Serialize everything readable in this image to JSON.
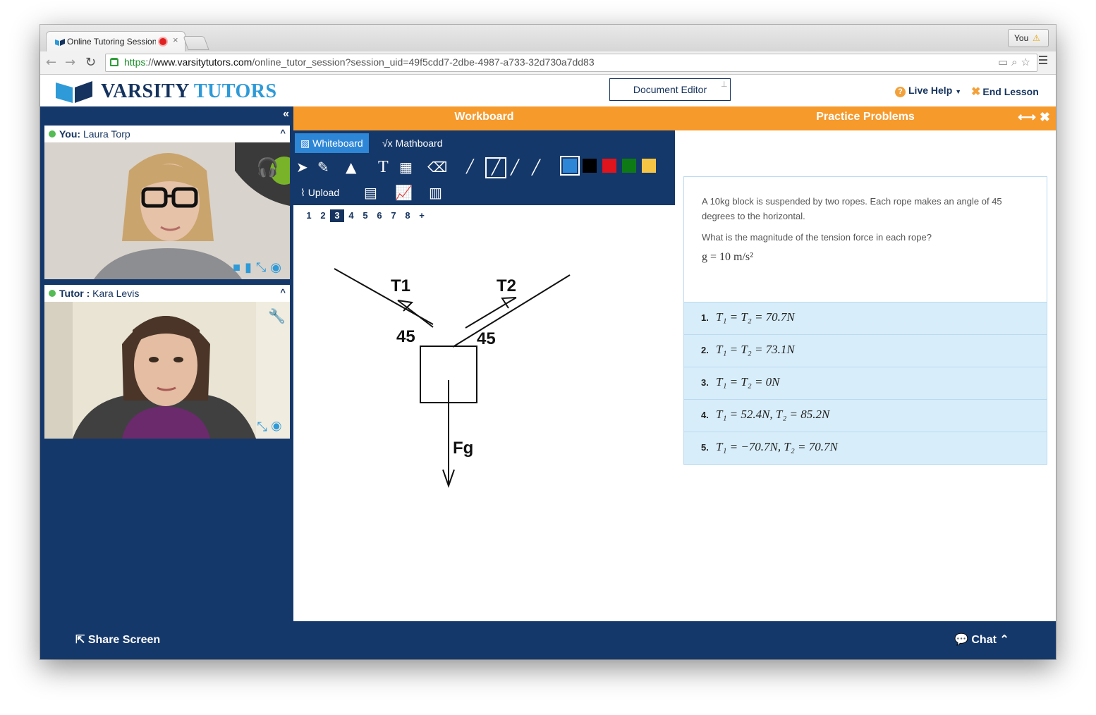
{
  "browser": {
    "tab_title": "Online Tutoring Session",
    "tab_close": "×",
    "user_button": "You",
    "url_https": "https",
    "url_sep": "://",
    "url_host": "www.varsitytutors.com",
    "url_path": "/online_tutor_session?session_uid=49f5cdd7-2dbe-4987-a733-32d730a7dd83"
  },
  "header": {
    "logo_part1": "VARSITY",
    "logo_part2": "TUTORS",
    "document_editor": "Document Editor",
    "live_help": "Live Help",
    "end_lesson": "End Lesson"
  },
  "videos": [
    {
      "role": "You:",
      "name": "Laura Torp"
    },
    {
      "role": "Tutor :",
      "name": "Kara Levis"
    }
  ],
  "workboard": {
    "title": "Workboard",
    "tabs": [
      "Whiteboard",
      "Mathboard"
    ],
    "upload": "Upload",
    "pages": [
      "1",
      "2",
      "3",
      "4",
      "5",
      "6",
      "7",
      "8",
      "+"
    ],
    "current_page": "3",
    "colors": [
      "#2e86d6",
      "#000000",
      "#e0141c",
      "#0e7a16",
      "#f6c544"
    ],
    "drawing": {
      "label_t1": "T1",
      "label_t2": "T2",
      "angle_left": "45",
      "angle_right": "45",
      "label_fg": "Fg"
    }
  },
  "practice": {
    "title": "Practice Problems",
    "question_line1": "A 10kg block is suspended by two ropes. Each rope makes an angle of 45 degrees to the horizontal.",
    "question_line2": "What is the magnitude of the tension force in each rope?",
    "formula": "g = 10 m/s²",
    "answers": [
      {
        "num": "1.",
        "expr": "T₁ = T₂ = 70.7N"
      },
      {
        "num": "2.",
        "expr": "T₁ = T₂ = 73.1N"
      },
      {
        "num": "3.",
        "expr": "T₁ = T₂ = 0N"
      },
      {
        "num": "4.",
        "expr": "T₁ = 52.4N, T₂ = 85.2N"
      },
      {
        "num": "5.",
        "expr": "T₁ = −70.7N, T₂ = 70.7N"
      }
    ]
  },
  "footer": {
    "share_screen": "Share Screen",
    "chat": "Chat"
  }
}
